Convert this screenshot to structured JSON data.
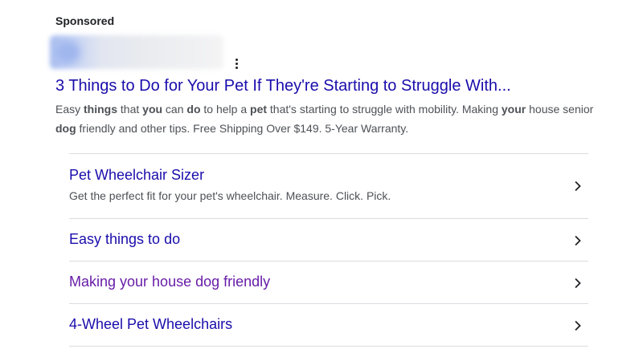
{
  "ad": {
    "label": "Sponsored",
    "headline": "3 Things to Do for Your Pet If They're Starting to Struggle With...",
    "description": {
      "segments": [
        {
          "text": "Easy ",
          "bold": false
        },
        {
          "text": "things",
          "bold": true
        },
        {
          "text": " that ",
          "bold": false
        },
        {
          "text": "you",
          "bold": true
        },
        {
          "text": " can ",
          "bold": false
        },
        {
          "text": "do",
          "bold": true
        },
        {
          "text": " to help a ",
          "bold": false
        },
        {
          "text": "pet",
          "bold": true
        },
        {
          "text": " that's starting to struggle with mobility. Making ",
          "bold": false
        },
        {
          "text": "your",
          "bold": true
        },
        {
          "text": " house senior ",
          "bold": false
        },
        {
          "text": "dog",
          "bold": true
        },
        {
          "text": " friendly and other tips. Free Shipping Over $149. 5-Year Warranty.",
          "bold": false
        }
      ]
    }
  },
  "sitelinks": [
    {
      "title": "Pet Wheelchair Sizer",
      "description": "Get the perfect fit for your pet's wheelchair. Measure. Click. Pick.",
      "visited": false
    },
    {
      "title": "Easy things to do",
      "description": "",
      "visited": false
    },
    {
      "title": "Making your house dog friendly",
      "description": "",
      "visited": true
    },
    {
      "title": "4-Wheel Pet Wheelchairs",
      "description": "",
      "visited": false
    }
  ],
  "icons": {
    "menu": "more-vert-icon",
    "chevron": "chevron-right-icon"
  },
  "colors": {
    "link": "#1a0dab",
    "visited_link": "#681da8",
    "body_text": "#4d5156",
    "divider": "#dadce0"
  }
}
